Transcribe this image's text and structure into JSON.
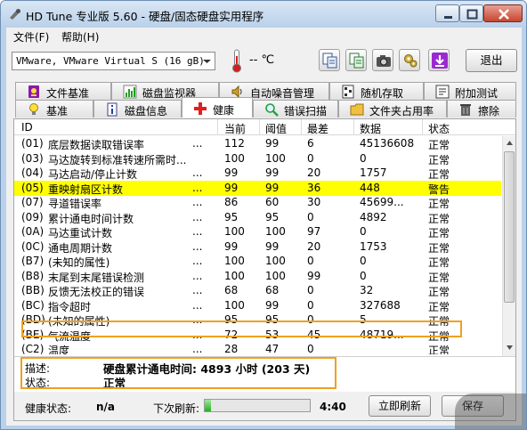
{
  "window": {
    "title": "HD Tune 专业版 5.60 - 硬盘/固态硬盘实用程序"
  },
  "menu": {
    "file": "文件(F)",
    "help": "帮助(H)"
  },
  "toolbar": {
    "drive": "VMware, VMware Virtual S (16 gB)",
    "temperature": "-- ℃",
    "exit_label": "退出"
  },
  "tabs": {
    "row1": [
      "文件基准",
      "磁盘监视器",
      "自动噪音管理",
      "随机存取",
      "附加测试"
    ],
    "row2": [
      "基准",
      "磁盘信息",
      "健康",
      "错误扫描",
      "文件夹占用率",
      "擦除"
    ],
    "active": "健康"
  },
  "table": {
    "headers": {
      "id": "ID",
      "current": "当前",
      "threshold": "阈值",
      "worst": "最差",
      "data": "数据",
      "status": "状态"
    },
    "dots": "...",
    "rows": [
      {
        "id": "(01)",
        "name": "底层数据读取错误率",
        "cur": "112",
        "thr": "99",
        "worst": "6",
        "data": "45136608",
        "status": "正常"
      },
      {
        "id": "(03)",
        "name": "马达旋转到标准转速所需时...",
        "cur": "100",
        "thr": "100",
        "worst": "0",
        "data": "0",
        "status": "正常"
      },
      {
        "id": "(04)",
        "name": "马达启动/停止计数",
        "cur": "99",
        "thr": "99",
        "worst": "20",
        "data": "1757",
        "status": "正常"
      },
      {
        "id": "(05)",
        "name": "重映射扇区计数",
        "cur": "99",
        "thr": "99",
        "worst": "36",
        "data": "448",
        "status": "警告"
      },
      {
        "id": "(07)",
        "name": "寻道错误率",
        "cur": "86",
        "thr": "60",
        "worst": "30",
        "data": "45699...",
        "status": "正常"
      },
      {
        "id": "(09)",
        "name": "累计通电时间计数",
        "cur": "95",
        "thr": "95",
        "worst": "0",
        "data": "4892",
        "status": "正常"
      },
      {
        "id": "(0A)",
        "name": "马达重试计数",
        "cur": "100",
        "thr": "100",
        "worst": "97",
        "data": "0",
        "status": "正常"
      },
      {
        "id": "(0C)",
        "name": "通电周期计数",
        "cur": "99",
        "thr": "99",
        "worst": "20",
        "data": "1753",
        "status": "正常"
      },
      {
        "id": "(B7)",
        "name": "(未知的属性)",
        "cur": "100",
        "thr": "100",
        "worst": "0",
        "data": "0",
        "status": "正常"
      },
      {
        "id": "(B8)",
        "name": "末尾到末尾错误检测",
        "cur": "100",
        "thr": "100",
        "worst": "99",
        "data": "0",
        "status": "正常"
      },
      {
        "id": "(BB)",
        "name": "反馈无法校正的错误",
        "cur": "68",
        "thr": "68",
        "worst": "0",
        "data": "32",
        "status": "正常"
      },
      {
        "id": "(BC)",
        "name": "指令超时",
        "cur": "100",
        "thr": "99",
        "worst": "0",
        "data": "327688",
        "status": "正常"
      },
      {
        "id": "(BD)",
        "name": "(未知的属性)",
        "cur": "95",
        "thr": "95",
        "worst": "0",
        "data": "5",
        "status": "正常"
      },
      {
        "id": "(BE)",
        "name": "气流温度",
        "cur": "72",
        "thr": "53",
        "worst": "45",
        "data": "48719...",
        "status": "正常"
      },
      {
        "id": "(C2)",
        "name": "温度",
        "cur": "28",
        "thr": "47",
        "worst": "0",
        "data": "",
        "status": "正常"
      }
    ]
  },
  "detail": {
    "desc_label": "描述:",
    "desc_value": "硬盘累计通电时间: 4893 小时 (203 天)",
    "status_label": "状态:",
    "status_value": "正常"
  },
  "bottom": {
    "health_label": "健康状态:",
    "health_value": "n/a",
    "refresh_label": "下次刷新:",
    "refresh_time": "4:40",
    "refresh_progress": 0.06,
    "refresh_btn": "立即刷新",
    "save_btn": "保存"
  },
  "colors": {
    "warning_row": "#ffff00",
    "highlight_box": "#f0a020"
  }
}
